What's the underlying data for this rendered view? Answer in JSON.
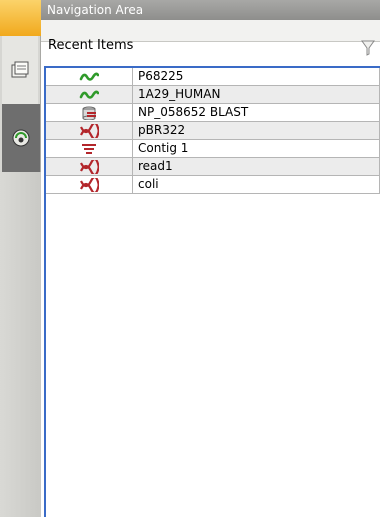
{
  "panel": {
    "title": "Navigation Area",
    "section_label": "Recent Items"
  },
  "items": [
    {
      "name": "P68225",
      "icon": "protein-sequence-icon",
      "color": "#2f9a2a"
    },
    {
      "name": "1A29_HUMAN",
      "icon": "protein-sequence-icon",
      "color": "#2f9a2a"
    },
    {
      "name": "NP_058652 BLAST",
      "icon": "blast-database-icon",
      "color": "#b3262b"
    },
    {
      "name": "pBR322",
      "icon": "dna-sequence-icon",
      "color": "#b3262b"
    },
    {
      "name": "Contig 1",
      "icon": "contig-icon",
      "color": "#b3262b"
    },
    {
      "name": "read1",
      "icon": "dna-sequence-icon",
      "color": "#b3262b"
    },
    {
      "name": "coli",
      "icon": "dna-sequence-icon",
      "color": "#b3262b"
    }
  ]
}
